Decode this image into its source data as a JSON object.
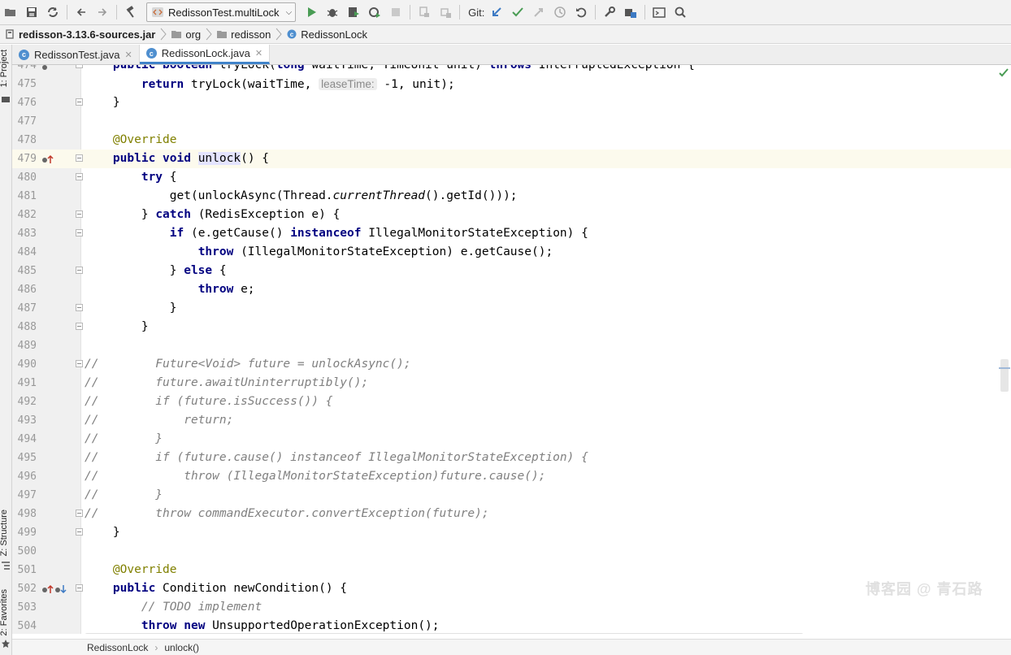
{
  "toolbar": {
    "run_config": "RedissonTest.multiLock",
    "git_label": "Git:",
    "icons": [
      "open-folder-icon",
      "save-icon",
      "sync-icon",
      "back-icon",
      "forward-icon",
      "build-hammer-icon",
      "run-icon",
      "debug-icon",
      "coverage-icon",
      "profile-icon",
      "stop-icon",
      "attach-icon",
      "vcs-update-icon",
      "git-update-icon",
      "git-commit-icon",
      "git-push-icon",
      "history-icon",
      "rollback-icon",
      "settings-wrench-icon",
      "project-structure-icon",
      "terminal-icon",
      "search-icon"
    ]
  },
  "breadcrumb": {
    "jar": "redisson-3.13.6-sources.jar",
    "pkg1": "org",
    "pkg2": "redisson",
    "cls": "RedissonLock"
  },
  "left_strip": {
    "project": "1: Project",
    "structure": "Z: Structure",
    "favorites": "2: Favorites"
  },
  "tabs": [
    {
      "label": "RedissonTest.java",
      "active": false
    },
    {
      "label": "RedissonLock.java",
      "active": true
    }
  ],
  "code": {
    "line_numbers": [
      "474",
      "475",
      "476",
      "477",
      "478",
      "479",
      "480",
      "481",
      "482",
      "483",
      "484",
      "485",
      "486",
      "487",
      "488",
      "489",
      "490",
      "491",
      "492",
      "493",
      "494",
      "495",
      "496",
      "497",
      "498",
      "499",
      "500",
      "501",
      "502",
      "503",
      "504"
    ],
    "l474": {
      "pre": "    ",
      "kw1": "public",
      "sp1": " ",
      "kw2": "boolean",
      "rest": " tryLock(",
      "kw3": "long",
      "rest2": " waitTime, TimeUnit unit) ",
      "kw4": "throws",
      "rest3": " InterruptedException {"
    },
    "l475": {
      "pre": "        ",
      "kw": "return",
      "mid": " tryLock(waitTime, ",
      "hint": "leaseTime:",
      "post": " -1, unit);"
    },
    "l476": "    }",
    "l478": "    @Override",
    "l479": {
      "pre": "    ",
      "kw1": "public",
      "sp": " ",
      "kw2": "void",
      "sp2": " ",
      "name": "unlock",
      "post": "() {"
    },
    "l480": {
      "pre": "        ",
      "kw": "try",
      "post": " {"
    },
    "l481": {
      "pre": "            get(unlockAsync(Thread.",
      "ital": "currentThread",
      "post": "().getId()));"
    },
    "l482": {
      "pre": "        } ",
      "kw": "catch",
      "post": " (RedisException e) {"
    },
    "l483": {
      "pre": "            ",
      "kw1": "if",
      "mid": " (e.getCause() ",
      "kw2": "instanceof",
      "post": " IllegalMonitorStateException) {"
    },
    "l484": {
      "pre": "                ",
      "kw": "throw",
      "post": " (IllegalMonitorStateException) e.getCause();"
    },
    "l485": {
      "pre": "            } ",
      "kw": "else",
      "post": " {"
    },
    "l486": {
      "pre": "                ",
      "kw": "throw",
      "post": " e;"
    },
    "l487": "            }",
    "l488": "        }",
    "l490": "//        Future<Void> future = unlockAsync();",
    "l491": "//        future.awaitUninterruptibly();",
    "l492": "//        if (future.isSuccess()) {",
    "l493": "//            return;",
    "l494": "//        }",
    "l495": "//        if (future.cause() instanceof IllegalMonitorStateException) {",
    "l496": "//            throw (IllegalMonitorStateException)future.cause();",
    "l497": "//        }",
    "l498": "//        throw commandExecutor.convertException(future);",
    "l499": "    }",
    "l501": "    @Override",
    "l502": {
      "pre": "    ",
      "kw": "public",
      "post": " Condition newCondition() {"
    },
    "l503": "        // TODO implement",
    "l504": {
      "pre": "        ",
      "kw1": "throw",
      "sp": " ",
      "kw2": "new",
      "post": " UnsupportedOperationException();"
    }
  },
  "watermark": "博客园 @ 青石路",
  "status": {
    "crumb1": "RedissonLock",
    "crumb2": "unlock()"
  },
  "colors": {
    "keyword": "#000080",
    "annotation": "#808000",
    "comment": "#808080",
    "current_line": "#fcfaed",
    "tab_underline": "#4083c9"
  }
}
